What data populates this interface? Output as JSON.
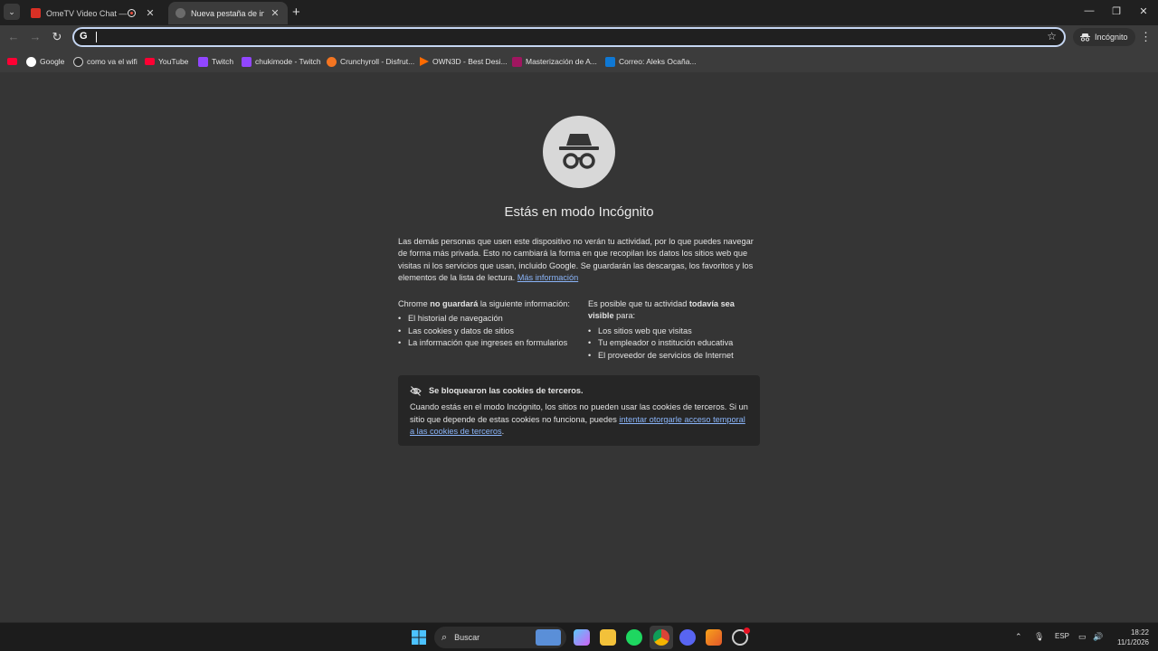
{
  "tabs": [
    {
      "title": "OmeTV Video Chat — Ome"
    },
    {
      "title": "Nueva pestaña de incógni"
    }
  ],
  "toolbar": {
    "omnibox_value": "",
    "incognito_label": "Incógnito"
  },
  "bookmarks": [
    {
      "label": "",
      "icon": "youtube-icon",
      "color": "#ff0033"
    },
    {
      "label": "Google",
      "icon": "google-icon",
      "color": "#ffffff"
    },
    {
      "label": "como va el wifi",
      "icon": "github-icon",
      "color": "#cccccc"
    },
    {
      "label": "YouTube",
      "icon": "youtube-icon",
      "color": "#ff0033"
    },
    {
      "label": "Twitch",
      "icon": "twitch-icon",
      "color": "#9146ff"
    },
    {
      "label": "chukimode - Twitch",
      "icon": "twitch-icon",
      "color": "#9146ff"
    },
    {
      "label": "Crunchyroll - Disfrut...",
      "icon": "crunchyroll-icon",
      "color": "#f47521"
    },
    {
      "label": "OWN3D - Best Desi...",
      "icon": "own3d-icon",
      "color": "#ff6a00"
    },
    {
      "label": "Masterización de A...",
      "icon": "page-icon",
      "color": "#a01660"
    },
    {
      "label": "Correo: Aleks Ocaña...",
      "icon": "outlook-icon",
      "color": "#0f78d4"
    }
  ],
  "incognito_page": {
    "title": "Estás en modo Incógnito",
    "description": "Las demás personas que usen este dispositivo no verán tu actividad, por lo que puedes navegar de forma más privada. Esto no cambiará la forma en que recopilan los datos los sitios web que visitas ni los servicios que usan, incluido Google. Se guardarán las descargas, los favoritos y los elementos de la lista de lectura.",
    "learn_more": "Más información",
    "left_col": {
      "heading_pre": "Chrome ",
      "heading_bold": "no guardará",
      "heading_post": " la siguiente información:",
      "items": [
        "El historial de navegación",
        "Las cookies y datos de sitios",
        "La información que ingreses en formularios"
      ]
    },
    "right_col": {
      "heading_pre": "Es posible que tu actividad ",
      "heading_bold": "todavía sea visible",
      "heading_post": " para:",
      "items": [
        "Los sitios web que visitas",
        "Tu empleador o institución educativa",
        "El proveedor de servicios de Internet"
      ]
    },
    "cookie_card": {
      "heading": "Se bloquearon las cookies de terceros.",
      "body": "Cuando estás en el modo Incógnito, los sitios no pueden usar las cookies de terceros. Si un sitio que depende de estas cookies no funciona, puedes ",
      "link": "intentar otorgarle acceso temporal a las cookies de terceros",
      "end": "."
    }
  },
  "taskbar": {
    "search_label": "Buscar",
    "language": "ESP",
    "time": "18:22",
    "date": "11/1/2026"
  }
}
